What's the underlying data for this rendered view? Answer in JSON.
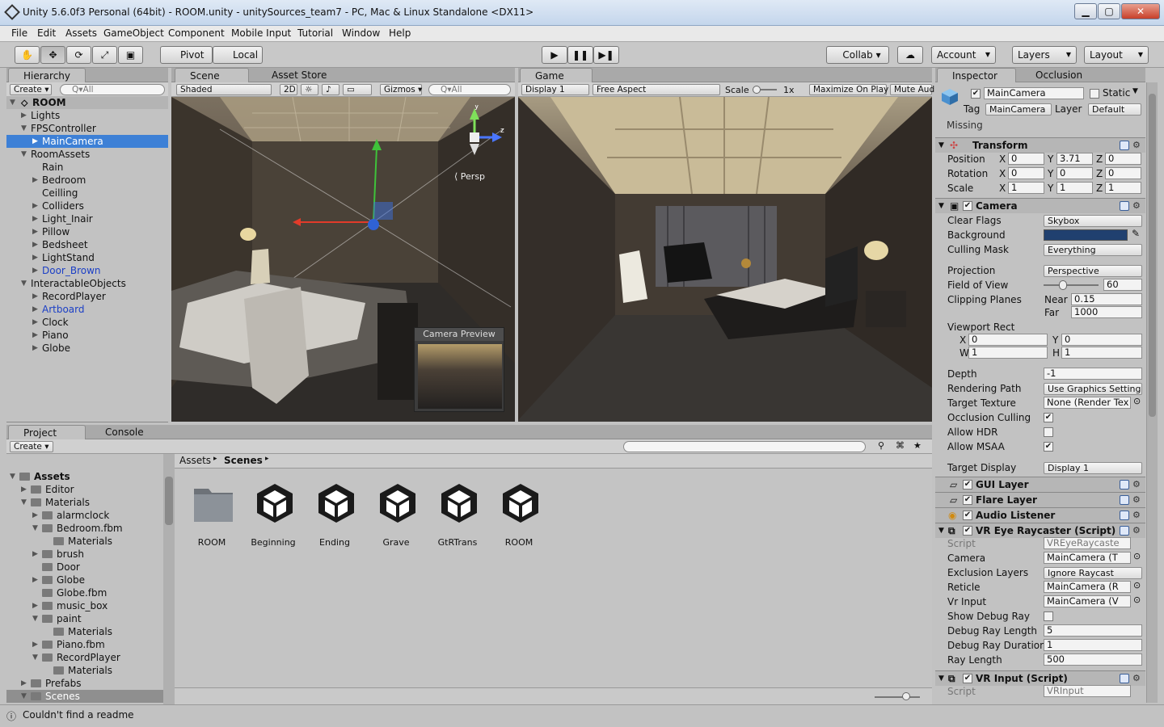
{
  "window": {
    "title": "Unity 5.6.0f3 Personal (64bit) - ROOM.unity - unitySources_team7 - PC, Mac & Linux Standalone <DX11>"
  },
  "menu": [
    "File",
    "Edit",
    "Assets",
    "GameObject",
    "Component",
    "Mobile Input",
    "Tutorial",
    "Window",
    "Help"
  ],
  "toolbar": {
    "pivot": "Pivot",
    "local": "Local",
    "collab": "Collab ▾",
    "account": "Account",
    "layers": "Layers",
    "layout": "Layout"
  },
  "hierarchy": {
    "tab": "Hierarchy",
    "create": "Create ▾",
    "search": "Q▾All",
    "scene": "ROOM",
    "items": [
      {
        "label": "Lights",
        "depth": 1,
        "arrow": "▶"
      },
      {
        "label": "FPSController",
        "depth": 1,
        "arrow": "▼"
      },
      {
        "label": "MainCamera",
        "depth": 2,
        "arrow": "▶",
        "selected": true
      },
      {
        "label": "RoomAssets",
        "depth": 1,
        "arrow": "▼"
      },
      {
        "label": "Rain",
        "depth": 2,
        "arrow": ""
      },
      {
        "label": "Bedroom",
        "depth": 2,
        "arrow": "▶"
      },
      {
        "label": "Ceilling",
        "depth": 2,
        "arrow": ""
      },
      {
        "label": "Colliders",
        "depth": 2,
        "arrow": "▶"
      },
      {
        "label": "Light_Inair",
        "depth": 2,
        "arrow": "▶"
      },
      {
        "label": "Pillow",
        "depth": 2,
        "arrow": "▶"
      },
      {
        "label": "Bedsheet",
        "depth": 2,
        "arrow": "▶"
      },
      {
        "label": "LightStand",
        "depth": 2,
        "arrow": "▶"
      },
      {
        "label": "Door_Brown",
        "depth": 2,
        "arrow": "▶",
        "prefab": true
      },
      {
        "label": "InteractableObjects",
        "depth": 1,
        "arrow": "▼"
      },
      {
        "label": "RecordPlayer",
        "depth": 2,
        "arrow": "▶"
      },
      {
        "label": "Artboard",
        "depth": 2,
        "arrow": "▶",
        "prefab": true
      },
      {
        "label": "Clock",
        "depth": 2,
        "arrow": "▶"
      },
      {
        "label": "Piano",
        "depth": 2,
        "arrow": "▶"
      },
      {
        "label": "Globe",
        "depth": 2,
        "arrow": "▶"
      }
    ]
  },
  "scene": {
    "tab": "Scene",
    "asset_store": "Asset Store",
    "shaded": "Shaded",
    "two_d": "2D",
    "gizmos": "Gizmos ▾",
    "search": "Q▾All",
    "persp": "Persp",
    "preview_title": "Camera Preview"
  },
  "game": {
    "tab": "Game",
    "display": "Display 1",
    "aspect": "Free Aspect",
    "scale_label": "Scale",
    "scale_value": "1x",
    "maximize": "Maximize On Play",
    "mute": "Mute Aud"
  },
  "inspector": {
    "tab": "Inspector",
    "occlusion_tab": "Occlusion",
    "object_name": "MainCamera",
    "static_label": "Static",
    "tag_label": "Tag",
    "tag_value": "MainCamera",
    "layer_label": "Layer",
    "layer_value": "Default",
    "missing": "Missing",
    "transform": {
      "title": "Transform",
      "position_label": "Position",
      "rotation_label": "Rotation",
      "scale_label": "Scale",
      "position": [
        "0",
        "3.71",
        "0"
      ],
      "rotation": [
        "0",
        "0",
        "0"
      ],
      "scale": [
        "1",
        "1",
        "1"
      ],
      "axes": [
        "X",
        "Y",
        "Z"
      ]
    },
    "camera": {
      "title": "Camera",
      "clear_flags_label": "Clear Flags",
      "clear_flags": "Skybox",
      "background_label": "Background",
      "background_color": "#20406f",
      "culling_mask_label": "Culling Mask",
      "culling_mask": "Everything",
      "projection_label": "Projection",
      "projection": "Perspective",
      "fov_label": "Field of View",
      "fov": "60",
      "fov_fraction": 0.33,
      "clipping_label": "Clipping Planes",
      "near_label": "Near",
      "near": "0.15",
      "far_label": "Far",
      "far": "1000",
      "viewport_label": "Viewport Rect",
      "vx_label": "X",
      "vx": "0",
      "vy_label": "Y",
      "vy": "0",
      "vw_label": "W",
      "vw": "1",
      "vh_label": "H",
      "vh": "1",
      "depth_label": "Depth",
      "depth": "-1",
      "rendering_path_label": "Rendering Path",
      "rendering_path": "Use Graphics Setting",
      "target_texture_label": "Target Texture",
      "target_texture": "None (Render Tex",
      "occlusion_culling_label": "Occlusion Culling",
      "occlusion_culling": true,
      "allow_hdr_label": "Allow HDR",
      "allow_hdr": false,
      "allow_msaa_label": "Allow MSAA",
      "allow_msaa": true,
      "target_display_label": "Target Display",
      "target_display": "Display 1"
    },
    "gui_layer": "GUI Layer",
    "flare_layer": "Flare Layer",
    "audio_listener": "Audio Listener",
    "vr_eye": {
      "title": "VR Eye Raycaster (Script)",
      "script_label": "Script",
      "script": "VREyeRaycaste",
      "camera_label": "Camera",
      "camera": "MainCamera (T",
      "exclusion_label": "Exclusion Layers",
      "exclusion": "Ignore Raycast",
      "reticle_label": "Reticle",
      "reticle": "MainCamera (R",
      "vr_input_label": "Vr Input",
      "vr_input": "MainCamera (V",
      "show_debug_label": "Show Debug Ray",
      "show_debug": false,
      "debug_len_label": "Debug Ray Length",
      "debug_len": "5",
      "debug_dur_label": "Debug Ray Duration",
      "debug_dur": "1",
      "ray_len_label": "Ray Length",
      "ray_len": "500"
    },
    "vr_input": {
      "title": "VR Input (Script)",
      "script_label": "Script",
      "script": "VRInput"
    }
  },
  "project": {
    "tab": "Project",
    "console_tab": "Console",
    "create": "Create ▾",
    "breadcrumb": [
      "Assets",
      "Scenes"
    ],
    "folders": [
      {
        "label": "Assets",
        "depth": 0,
        "arrow": "▼",
        "bold": true
      },
      {
        "label": "Editor",
        "depth": 1,
        "arrow": "▶"
      },
      {
        "label": "Materials",
        "depth": 1,
        "arrow": "▼"
      },
      {
        "label": "alarmclock",
        "depth": 2,
        "arrow": "▶"
      },
      {
        "label": "Bedroom.fbm",
        "depth": 2,
        "arrow": "▼"
      },
      {
        "label": "Materials",
        "depth": 3,
        "arrow": ""
      },
      {
        "label": "brush",
        "depth": 2,
        "arrow": "▶"
      },
      {
        "label": "Door",
        "depth": 2,
        "arrow": ""
      },
      {
        "label": "Globe",
        "depth": 2,
        "arrow": "▶"
      },
      {
        "label": "Globe.fbm",
        "depth": 2,
        "arrow": ""
      },
      {
        "label": "music_box",
        "depth": 2,
        "arrow": "▶"
      },
      {
        "label": "paint",
        "depth": 2,
        "arrow": "▼"
      },
      {
        "label": "Materials",
        "depth": 3,
        "arrow": ""
      },
      {
        "label": "Piano.fbm",
        "depth": 2,
        "arrow": "▶"
      },
      {
        "label": "RecordPlayer",
        "depth": 2,
        "arrow": "▼"
      },
      {
        "label": "Materials",
        "depth": 3,
        "arrow": ""
      },
      {
        "label": "Prefabs",
        "depth": 1,
        "arrow": "▶"
      },
      {
        "label": "Scenes",
        "depth": 1,
        "arrow": "▼",
        "selected": true
      }
    ],
    "assets": [
      {
        "label": "ROOM",
        "kind": "folder"
      },
      {
        "label": "Beginning",
        "kind": "unity"
      },
      {
        "label": "Ending",
        "kind": "unity"
      },
      {
        "label": "Grave",
        "kind": "unity"
      },
      {
        "label": "GtRTrans",
        "kind": "unity"
      },
      {
        "label": "ROOM",
        "kind": "unity"
      }
    ]
  },
  "status": {
    "message": "Couldn't find a readme"
  }
}
